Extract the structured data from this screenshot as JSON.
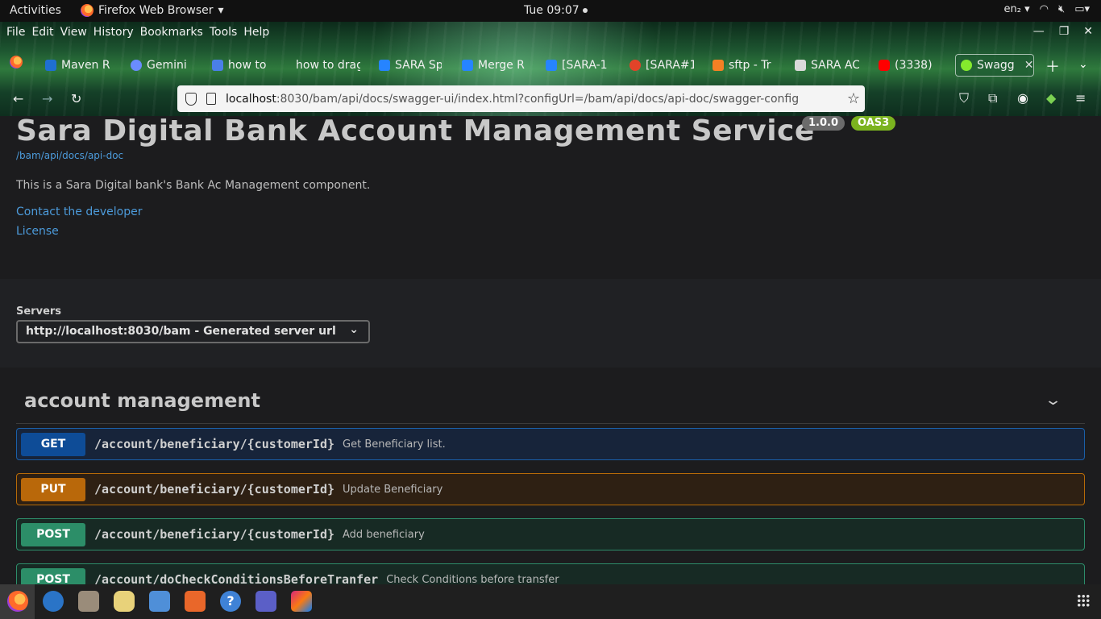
{
  "topbar": {
    "activities": "Activities",
    "app_name": "Firefox Web Browser",
    "clock": "Tue 09:07",
    "input_lang": "en₂"
  },
  "menu": [
    "File",
    "Edit",
    "View",
    "History",
    "Bookmarks",
    "Tools",
    "Help"
  ],
  "tabs": [
    {
      "label": "Maven R",
      "fav_color": "#1f6fd1"
    },
    {
      "label": "Gemini",
      "fav_color": "#6a8cff"
    },
    {
      "label": "how to d",
      "fav_color": "#4a7fe8"
    },
    {
      "label": "how to drag",
      "fav_color": "#666666"
    },
    {
      "label": "SARA Sp",
      "fav_color": "#2684ff"
    },
    {
      "label": "Merge R",
      "fav_color": "#2684ff"
    },
    {
      "label": "[SARA-1",
      "fav_color": "#2684ff"
    },
    {
      "label": "[SARA#1",
      "fav_color": "#e24329"
    },
    {
      "label": "sftp - Tr",
      "fav_color": "#f48024"
    },
    {
      "label": "SARA AC",
      "fav_color": "#d9d9d9"
    },
    {
      "label": "(3338)",
      "fav_color": "#ff0000"
    },
    {
      "label": "Swagg",
      "fav_color": "#85ea2d"
    }
  ],
  "url": {
    "host": "localhost",
    "rest": ":8030/bam/api/docs/swagger-ui/index.html?configUrl=/bam/api/docs/api-doc/swagger-config"
  },
  "info": {
    "title": "Sara Digital Bank Account Management Service",
    "version": "1.0.0",
    "oas": "OAS3",
    "doc_link": "/bam/api/docs/api-doc",
    "description": "This is a Sara Digital bank's Bank Ac Management component.",
    "contact": "Contact the developer",
    "license": "License"
  },
  "servers": {
    "label": "Servers",
    "selected": "http://localhost:8030/bam - Generated server url"
  },
  "section": {
    "tag": "account management",
    "operations": [
      {
        "method": "GET",
        "path": "/account/beneficiary/{customerId}",
        "summary": "Get Beneficiary list."
      },
      {
        "method": "PUT",
        "path": "/account/beneficiary/{customerId}",
        "summary": "Update Beneficiary"
      },
      {
        "method": "POST",
        "path": "/account/beneficiary/{customerId}",
        "summary": "Add beneficiary"
      },
      {
        "method": "POST",
        "path": "/account/doCheckConditionsBeforeTranfer",
        "summary": "Check Conditions before transfer"
      }
    ]
  },
  "dock": [
    {
      "name": "firefox",
      "color": "#ff7139"
    },
    {
      "name": "thunderbird",
      "color": "#2a74c7"
    },
    {
      "name": "files",
      "color": "#9a8c7a"
    },
    {
      "name": "vpn",
      "color": "#e8d27a"
    },
    {
      "name": "writer",
      "color": "#4f8fd8"
    },
    {
      "name": "software",
      "color": "#e9672a"
    },
    {
      "name": "help",
      "color": "#3f82d6"
    },
    {
      "name": "teams",
      "color": "#5b5fc7"
    },
    {
      "name": "intellij",
      "color": "#d6267a"
    }
  ]
}
